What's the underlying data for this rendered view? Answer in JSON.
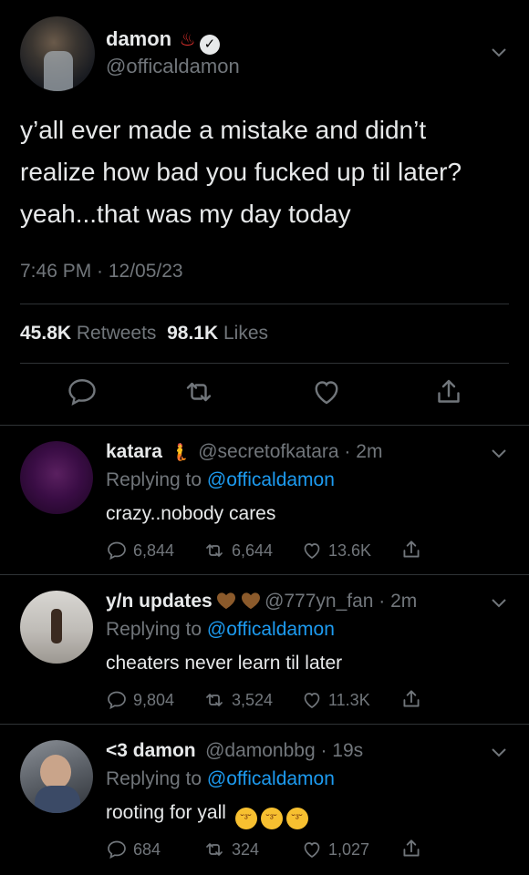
{
  "tweet": {
    "display_name": "damon",
    "handle": "@officaldamon",
    "name_emoji": "♨",
    "text": "y’all ever made a mistake and didn’t realize how bad you fucked up til later? yeah...that was my day today",
    "time": "7:46 PM · 12/05/23",
    "retweets_count": "45.8K",
    "retweets_label": "Retweets",
    "likes_count": "98.1K",
    "likes_label": "Likes"
  },
  "actions": {
    "reply": "reply-icon",
    "retweet": "retweet-icon",
    "like": "heart-icon",
    "share": "share-icon"
  },
  "replies": [
    {
      "name": "katara",
      "handle": "@secretofkatara · 2m",
      "replying_prefix": "Replying to",
      "replying_to": "@officaldamon",
      "text": "crazy..nobody cares",
      "replies": "6,844",
      "retweets": "6,644",
      "likes": "13.6K"
    },
    {
      "name": "y/n updates",
      "handle": "@777yn_fan · 2m",
      "replying_prefix": "Replying to",
      "replying_to": "@officaldamon",
      "text": "cheaters never learn til later",
      "replies": "9,804",
      "retweets": "3,524",
      "likes": "11.3K"
    },
    {
      "name": "<3 damon",
      "handle": "@damonbbg · 19s",
      "replying_prefix": "Replying to",
      "replying_to": "@officaldamon",
      "text": "rooting for yall",
      "replies": "684",
      "retweets": "324",
      "likes": "1,027"
    }
  ],
  "colors": {
    "background": "#000000",
    "text": "#e7e9ea",
    "muted": "#71767b",
    "link": "#1d9bf0",
    "divider": "#2f3336"
  }
}
